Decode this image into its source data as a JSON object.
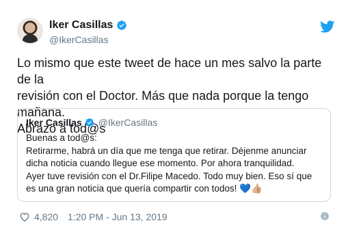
{
  "tweet": {
    "display_name": "Iker Casillas",
    "handle": "@IkerCasillas",
    "text": "Lo mismo que este tweet de hace un mes salvo la parte de la\nrevisión con el Doctor. Más que nada porque la tengo mañana.\nAbrazo a tod@s",
    "likes": "4,820",
    "timestamp": "1:20 PM - Jun 13, 2019"
  },
  "quoted_tweet": {
    "display_name": "Iker Casillas",
    "handle": "@IkerCasillas",
    "text": "Buenas a tod@s:\nRetirarme, habrá un día que me tenga que retirar. Déjenme anunciar\ndicha noticia cuando llegue ese momento. Por ahora tranquilidad.\nAyer tuve revisión con el Dr.Filipe Macedo. Todo muy bien. Eso sí que\nes una gran noticia que quería compartir con todos!",
    "emojis": "💙👍🏼"
  },
  "colors": {
    "twitter_blue": "#1da1f2",
    "secondary_text": "#657786",
    "border": "#ccd6dd"
  },
  "icons": [
    "verified-badge-icon",
    "twitter-bird-icon",
    "heart-icon",
    "info-icon"
  ]
}
